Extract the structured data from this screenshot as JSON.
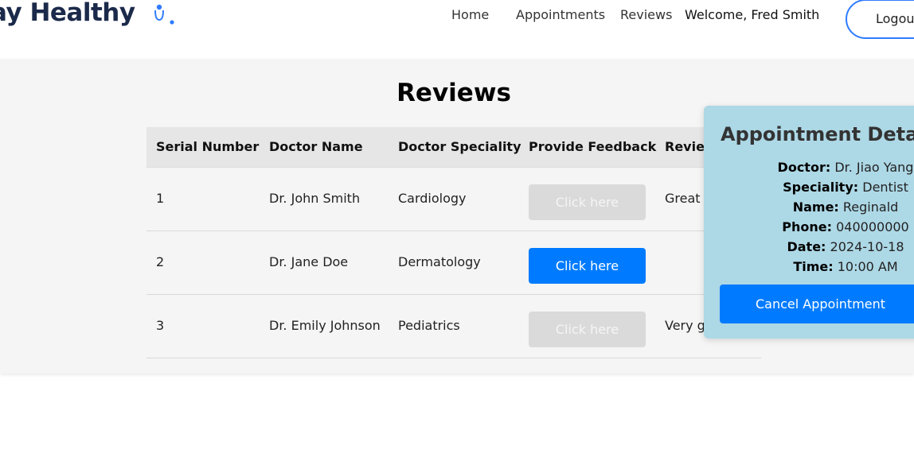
{
  "navbar": {
    "logo_text": "ay Healthy",
    "links": [
      {
        "label": "Home"
      },
      {
        "label": "Appointments"
      },
      {
        "label": "Reviews"
      }
    ],
    "welcome": "Welcome, Fred Smith",
    "logout_label": "Logout",
    "accent_color": "#2f7bff"
  },
  "reviews": {
    "title": "Reviews",
    "columns": [
      "Serial Number",
      "Doctor Name",
      "Doctor Speciality",
      "Provide Feedback",
      "Review"
    ],
    "rows": [
      {
        "serial": "1",
        "doctor": "Dr. John Smith",
        "speciality": "Cardiology",
        "feedback_label": "Click here",
        "feedback_enabled": false,
        "review": "Great"
      },
      {
        "serial": "2",
        "doctor": "Dr. Jane Doe",
        "speciality": "Dermatology",
        "feedback_label": "Click here",
        "feedback_enabled": true,
        "review": ""
      },
      {
        "serial": "3",
        "doctor": "Dr. Emily Johnson",
        "speciality": "Pediatrics",
        "feedback_label": "Click here",
        "feedback_enabled": false,
        "review": "Very g"
      }
    ]
  },
  "appointment_popup": {
    "title": "Appointment Details",
    "fields": [
      {
        "label": "Doctor:",
        "value": "Dr. Jiao Yang"
      },
      {
        "label": "Speciality:",
        "value": "Dentist"
      },
      {
        "label": "Name:",
        "value": "Reginald"
      },
      {
        "label": "Phone:",
        "value": "040000000"
      },
      {
        "label": "Date:",
        "value": "2024-10-18"
      },
      {
        "label": "Time:",
        "value": "10:00 AM"
      }
    ],
    "cancel_label": "Cancel Appointment",
    "background_color": "#add8e6",
    "button_color": "#007bff"
  }
}
